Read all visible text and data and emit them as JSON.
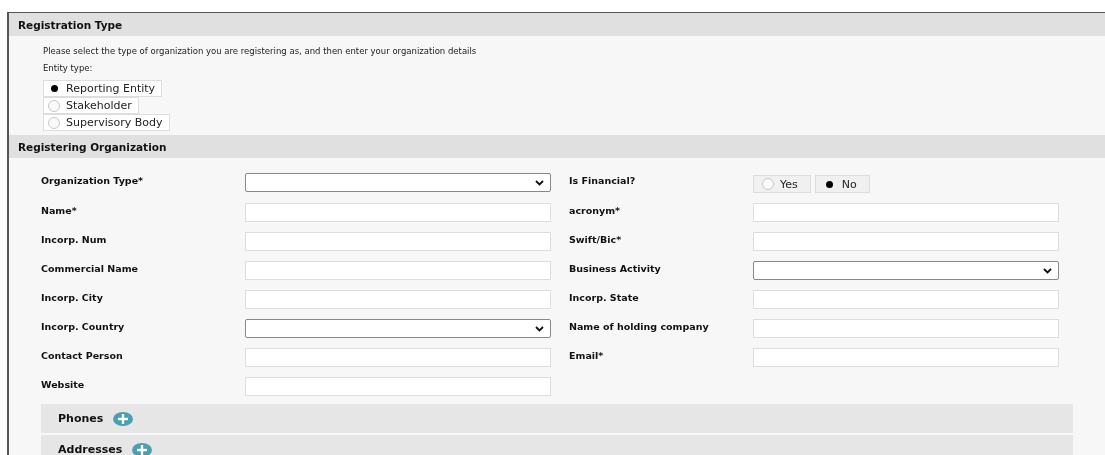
{
  "registration_type": {
    "title": "Registration Type",
    "description": "Please select the type of organization you are registering as, and then enter your organization details",
    "entity_label": "Entity type:",
    "entity_options": [
      {
        "label": "Reporting Entity",
        "selected": true
      },
      {
        "label": "Stakeholder",
        "selected": false
      },
      {
        "label": "Supervisory Body",
        "selected": false
      }
    ]
  },
  "registering_organization": {
    "title": "Registering Organization",
    "fields": [
      {
        "label": "Organization Type*",
        "kind": "select"
      },
      {
        "label": "Is Financial?",
        "kind": "radio",
        "options": [
          {
            "label": "Yes",
            "selected": false
          },
          {
            "label": "No",
            "selected": true
          }
        ]
      },
      {
        "label": "Name*",
        "kind": "text"
      },
      {
        "label": "acronym*",
        "kind": "text"
      },
      {
        "label": "Incorp. Num",
        "kind": "text"
      },
      {
        "label": "Swift/Bic*",
        "kind": "text"
      },
      {
        "label": "Commercial Name",
        "kind": "text"
      },
      {
        "label": "Business Activity",
        "kind": "select"
      },
      {
        "label": "Incorp. City",
        "kind": "text"
      },
      {
        "label": "Incorp. State",
        "kind": "text"
      },
      {
        "label": "Incorp. Country",
        "kind": "select"
      },
      {
        "label": "Name of holding company",
        "kind": "text"
      },
      {
        "label": "Contact Person",
        "kind": "text"
      },
      {
        "label": "Email*",
        "kind": "text"
      },
      {
        "label": "Website",
        "kind": "text"
      }
    ],
    "sections": [
      {
        "label": "Phones"
      },
      {
        "label": "Addresses"
      }
    ]
  }
}
